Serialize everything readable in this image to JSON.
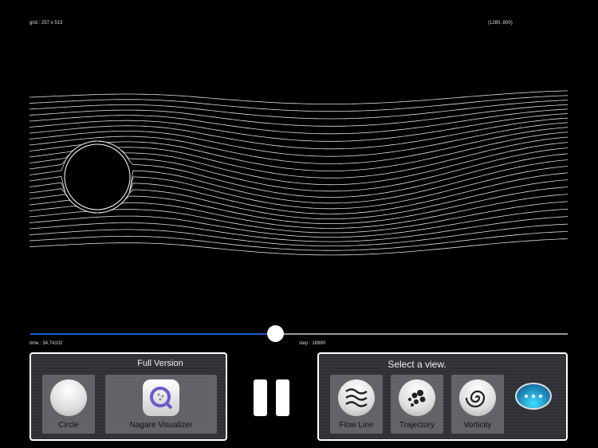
{
  "header": {
    "grid": "grid : 257 x 513",
    "resolution": "(1280, 800)"
  },
  "playback": {
    "time": "time : 34.74102",
    "step": "step : 18990",
    "progress": 0.455
  },
  "left_panel": {
    "title": "Full Version",
    "items": [
      {
        "label": "Circle",
        "icon": "circle-icon"
      },
      {
        "label": "Nagare Visualizer",
        "icon": "app-icon"
      }
    ]
  },
  "right_panel": {
    "title": "Select a view.",
    "items": [
      {
        "label": "Flow Line",
        "icon": "waves-icon"
      },
      {
        "label": "Trajectory",
        "icon": "particles-icon"
      },
      {
        "label": "Vorticity",
        "icon": "spiral-icon"
      }
    ],
    "more_icon": "chat-bubble-icon"
  },
  "colors": {
    "accent": "#1a5fd0",
    "chat": "#27c4e8"
  }
}
